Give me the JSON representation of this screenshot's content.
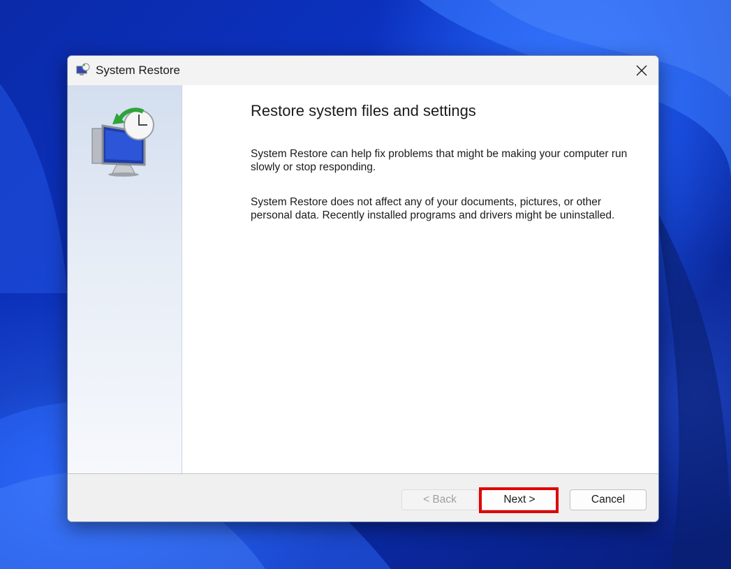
{
  "dialog": {
    "title": "System Restore",
    "app_icon": "system-restore-icon",
    "close_icon": "close-icon"
  },
  "content": {
    "heading": "Restore system files and settings",
    "paragraph1": "System Restore can help fix problems that might be making your computer run slowly or stop responding.",
    "paragraph2": "System Restore does not affect any of your documents, pictures, or other personal data. Recently installed programs and drivers might be uninstalled."
  },
  "buttons": {
    "back": "< Back",
    "next": "Next >",
    "cancel": "Cancel"
  },
  "colors": {
    "highlight": "#e00000",
    "wallpaper": "#0c33c4"
  }
}
